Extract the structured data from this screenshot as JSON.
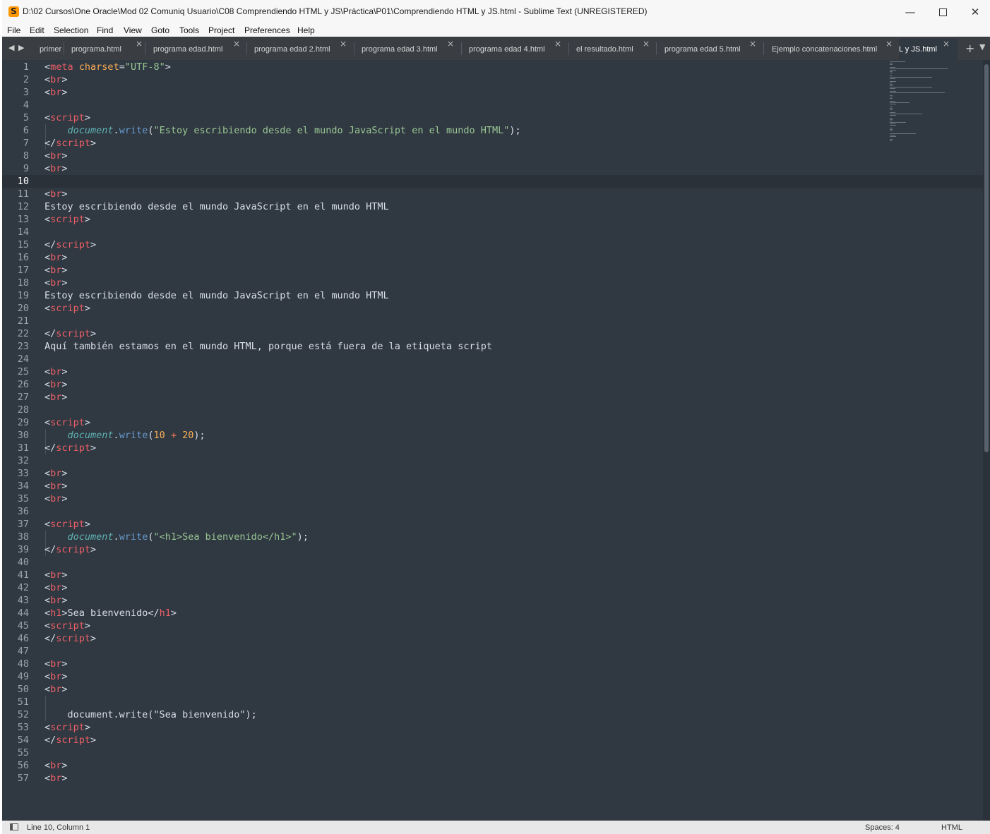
{
  "window": {
    "title": "D:\\02 Cursos\\One Oracle\\Mod 02 Comuniq Usuario\\C08 Comprendiendo HTML y JS\\Práctica\\P01\\Comprendiendo HTML y JS.html - Sublime Text (UNREGISTERED)",
    "app_icon": "S",
    "minimize": "—",
    "close": "✕"
  },
  "menu": [
    "File",
    "Edit",
    "Selection",
    "Find",
    "View",
    "Goto",
    "Tools",
    "Project",
    "Preferences",
    "Help"
  ],
  "tabs": [
    {
      "label": "primer",
      "close": ""
    },
    {
      "label": "programa.html",
      "close": "×"
    },
    {
      "label": "programa edad.html",
      "close": "×"
    },
    {
      "label": "programa edad 2.html",
      "close": "×"
    },
    {
      "label": "programa edad 3.html",
      "close": "×"
    },
    {
      "label": "programa edad 4.html",
      "close": "×"
    },
    {
      "label": "el resultado.html",
      "close": "×"
    },
    {
      "label": "programa edad 5.html",
      "close": "×"
    },
    {
      "label": "Ejemplo concatenaciones.html",
      "close": "×"
    },
    {
      "label": "L y JS.html",
      "close": "×"
    }
  ],
  "tabbar": {
    "prev": "◀",
    "next": "▶",
    "new_tab": "+",
    "tabs_menu": "▼"
  },
  "editor": {
    "current_line": 10,
    "line_numbers": [
      "1",
      "2",
      "3",
      "4",
      "5",
      "6",
      "7",
      "8",
      "9",
      "10",
      "11",
      "12",
      "13",
      "14",
      "15",
      "16",
      "17",
      "18",
      "19",
      "20",
      "21",
      "22",
      "23",
      "24",
      "25",
      "26",
      "27",
      "28",
      "29",
      "30",
      "31",
      "32",
      "33",
      "34",
      "35",
      "36",
      "37",
      "38",
      "39",
      "40",
      "41",
      "42",
      "43",
      "44",
      "45",
      "46",
      "47",
      "48",
      "49",
      "50",
      "51",
      "52",
      "53",
      "54",
      "55",
      "56",
      "57"
    ],
    "lines": [
      [
        [
          "punc",
          "<"
        ],
        [
          "tag",
          "meta"
        ],
        [
          "text",
          " "
        ],
        [
          "attr",
          "charset"
        ],
        [
          "punc",
          "="
        ],
        [
          "string",
          "\"UTF-8\""
        ],
        [
          "punc",
          ">"
        ]
      ],
      [
        [
          "punc",
          "<"
        ],
        [
          "tag",
          "br"
        ],
        [
          "punc",
          ">"
        ]
      ],
      [
        [
          "punc",
          "<"
        ],
        [
          "tag",
          "br"
        ],
        [
          "punc",
          ">"
        ]
      ],
      [],
      [
        [
          "punc",
          "<"
        ],
        [
          "tag",
          "script"
        ],
        [
          "punc",
          ">"
        ]
      ],
      [
        [
          "text",
          "    "
        ],
        [
          "obj",
          "document"
        ],
        [
          "punc",
          "."
        ],
        [
          "method",
          "write"
        ],
        [
          "punc",
          "("
        ],
        [
          "string",
          "\"Estoy escribiendo desde el mundo JavaScript en el mundo HTML\""
        ],
        [
          "punc",
          ");"
        ]
      ],
      [
        [
          "punc",
          "</"
        ],
        [
          "tag",
          "script"
        ],
        [
          "punc",
          ">"
        ]
      ],
      [
        [
          "punc",
          "<"
        ],
        [
          "tag",
          "br"
        ],
        [
          "punc",
          ">"
        ]
      ],
      [
        [
          "punc",
          "<"
        ],
        [
          "tag",
          "br"
        ],
        [
          "punc",
          ">"
        ]
      ],
      [],
      [
        [
          "punc",
          "<"
        ],
        [
          "tag",
          "br"
        ],
        [
          "punc",
          ">"
        ]
      ],
      [
        [
          "text",
          "Estoy escribiendo desde el mundo JavaScript en el mundo HTML"
        ]
      ],
      [
        [
          "punc",
          "<"
        ],
        [
          "tag",
          "script"
        ],
        [
          "punc",
          ">"
        ]
      ],
      [],
      [
        [
          "punc",
          "</"
        ],
        [
          "tag",
          "script"
        ],
        [
          "punc",
          ">"
        ]
      ],
      [
        [
          "punc",
          "<"
        ],
        [
          "tag",
          "br"
        ],
        [
          "punc",
          ">"
        ]
      ],
      [
        [
          "punc",
          "<"
        ],
        [
          "tag",
          "br"
        ],
        [
          "punc",
          ">"
        ]
      ],
      [
        [
          "punc",
          "<"
        ],
        [
          "tag",
          "br"
        ],
        [
          "punc",
          ">"
        ]
      ],
      [
        [
          "text",
          "Estoy escribiendo desde el mundo JavaScript en el mundo HTML"
        ]
      ],
      [
        [
          "punc",
          "<"
        ],
        [
          "tag",
          "script"
        ],
        [
          "punc",
          ">"
        ]
      ],
      [],
      [
        [
          "punc",
          "</"
        ],
        [
          "tag",
          "script"
        ],
        [
          "punc",
          ">"
        ]
      ],
      [
        [
          "text",
          "Aquí también estamos en el mundo HTML, porque está fuera de la etiqueta script"
        ]
      ],
      [],
      [
        [
          "punc",
          "<"
        ],
        [
          "tag",
          "br"
        ],
        [
          "punc",
          ">"
        ]
      ],
      [
        [
          "punc",
          "<"
        ],
        [
          "tag",
          "br"
        ],
        [
          "punc",
          ">"
        ]
      ],
      [
        [
          "punc",
          "<"
        ],
        [
          "tag",
          "br"
        ],
        [
          "punc",
          ">"
        ]
      ],
      [],
      [
        [
          "punc",
          "<"
        ],
        [
          "tag",
          "script"
        ],
        [
          "punc",
          ">"
        ]
      ],
      [
        [
          "text",
          "    "
        ],
        [
          "obj",
          "document"
        ],
        [
          "punc",
          "."
        ],
        [
          "method",
          "write"
        ],
        [
          "punc",
          "("
        ],
        [
          "number",
          "10"
        ],
        [
          "text",
          " "
        ],
        [
          "op",
          "+"
        ],
        [
          "text",
          " "
        ],
        [
          "number",
          "20"
        ],
        [
          "punc",
          ");"
        ]
      ],
      [
        [
          "punc",
          "</"
        ],
        [
          "tag",
          "script"
        ],
        [
          "punc",
          ">"
        ]
      ],
      [],
      [
        [
          "punc",
          "<"
        ],
        [
          "tag",
          "br"
        ],
        [
          "punc",
          ">"
        ]
      ],
      [
        [
          "punc",
          "<"
        ],
        [
          "tag",
          "br"
        ],
        [
          "punc",
          ">"
        ]
      ],
      [
        [
          "punc",
          "<"
        ],
        [
          "tag",
          "br"
        ],
        [
          "punc",
          ">"
        ]
      ],
      [],
      [
        [
          "punc",
          "<"
        ],
        [
          "tag",
          "script"
        ],
        [
          "punc",
          ">"
        ]
      ],
      [
        [
          "text",
          "    "
        ],
        [
          "obj",
          "document"
        ],
        [
          "punc",
          "."
        ],
        [
          "method",
          "write"
        ],
        [
          "punc",
          "("
        ],
        [
          "string",
          "\"<h1>Sea bienvenido</h1>\""
        ],
        [
          "punc",
          ");"
        ]
      ],
      [
        [
          "punc",
          "</"
        ],
        [
          "tag",
          "script"
        ],
        [
          "punc",
          ">"
        ]
      ],
      [],
      [
        [
          "punc",
          "<"
        ],
        [
          "tag",
          "br"
        ],
        [
          "punc",
          ">"
        ]
      ],
      [
        [
          "punc",
          "<"
        ],
        [
          "tag",
          "br"
        ],
        [
          "punc",
          ">"
        ]
      ],
      [
        [
          "punc",
          "<"
        ],
        [
          "tag",
          "br"
        ],
        [
          "punc",
          ">"
        ]
      ],
      [
        [
          "punc",
          "<"
        ],
        [
          "tag",
          "h1"
        ],
        [
          "punc",
          ">"
        ],
        [
          "text",
          "Sea bienvenido"
        ],
        [
          "punc",
          "</"
        ],
        [
          "tag",
          "h1"
        ],
        [
          "punc",
          ">"
        ]
      ],
      [
        [
          "punc",
          "<"
        ],
        [
          "tag",
          "script"
        ],
        [
          "punc",
          ">"
        ]
      ],
      [
        [
          "punc",
          "</"
        ],
        [
          "tag",
          "script"
        ],
        [
          "punc",
          ">"
        ]
      ],
      [],
      [
        [
          "punc",
          "<"
        ],
        [
          "tag",
          "br"
        ],
        [
          "punc",
          ">"
        ]
      ],
      [
        [
          "punc",
          "<"
        ],
        [
          "tag",
          "br"
        ],
        [
          "punc",
          ">"
        ]
      ],
      [
        [
          "punc",
          "<"
        ],
        [
          "tag",
          "br"
        ],
        [
          "punc",
          ">"
        ]
      ],
      [],
      [
        [
          "text",
          "    document.write(\"Sea bienvenido\");"
        ]
      ],
      [
        [
          "punc",
          "<"
        ],
        [
          "tag",
          "script"
        ],
        [
          "punc",
          ">"
        ]
      ],
      [
        [
          "punc",
          "</"
        ],
        [
          "tag",
          "script"
        ],
        [
          "punc",
          ">"
        ]
      ],
      [],
      [
        [
          "punc",
          "<"
        ],
        [
          "tag",
          "br"
        ],
        [
          "punc",
          ">"
        ]
      ],
      [
        [
          "punc",
          "<"
        ],
        [
          "tag",
          "br"
        ],
        [
          "punc",
          ">"
        ]
      ]
    ]
  },
  "status": {
    "position": "Line 10, Column 1",
    "spaces": "Spaces: 4",
    "syntax": "HTML"
  },
  "colors": {
    "editor_bg": "#303841",
    "tag": "#ec5f66",
    "string": "#99c794",
    "method": "#6699cc",
    "object": "#5fb4b4",
    "number": "#f9ae58"
  },
  "icons": {
    "app": "sublime-text-icon",
    "panel": "side-panel-icon"
  }
}
